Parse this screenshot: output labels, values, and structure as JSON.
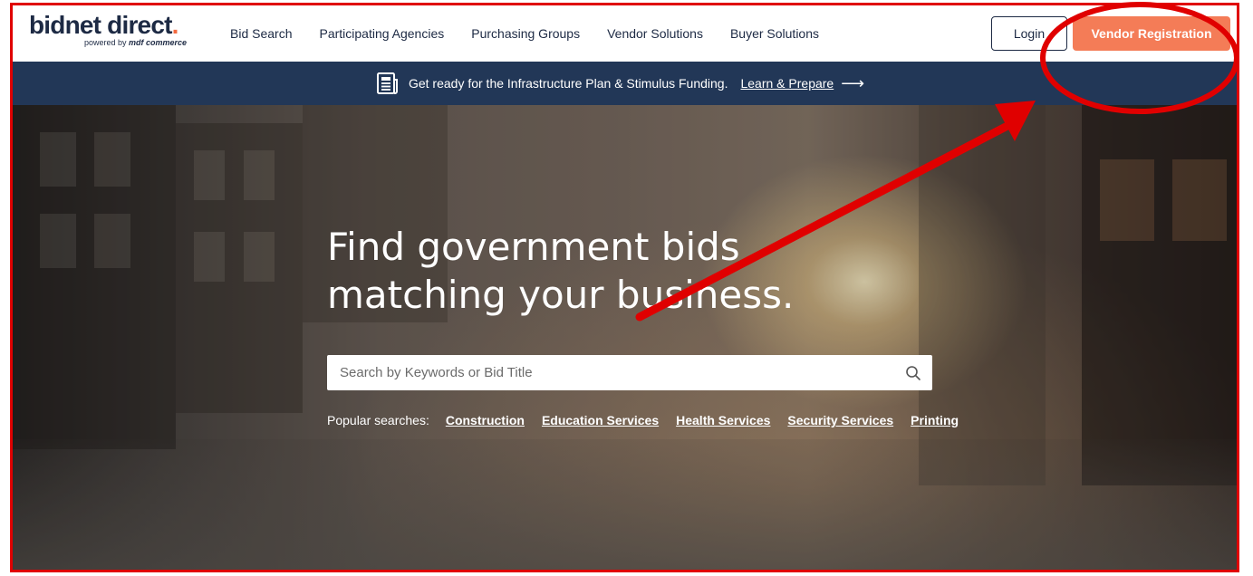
{
  "logo": {
    "main": "bidnet direct",
    "dot": ".",
    "sub_prefix": "powered by ",
    "sub_brand": "mdf commerce"
  },
  "nav": {
    "links": [
      "Bid Search",
      "Participating Agencies",
      "Purchasing Groups",
      "Vendor Solutions",
      "Buyer Solutions"
    ],
    "login_label": "Login",
    "register_label": "Vendor Registration"
  },
  "banner": {
    "icon": "news-icon",
    "text": "Get ready for the Infrastructure Plan & Stimulus Funding.",
    "link": "Learn & Prepare",
    "arrow": "⟶"
  },
  "hero": {
    "headline_line1": "Find government bids",
    "headline_line2": "matching your business.",
    "search_placeholder": "Search by Keywords or Bid Title",
    "popular_label": "Popular searches:",
    "popular_links": [
      "Construction",
      "Education Services",
      "Health Services",
      "Security Services",
      "Printing"
    ]
  },
  "colors": {
    "brand_navy": "#1d2a44",
    "accent_orange": "#f47c57",
    "banner_bg": "#223757",
    "annotation_red": "#e00000"
  }
}
